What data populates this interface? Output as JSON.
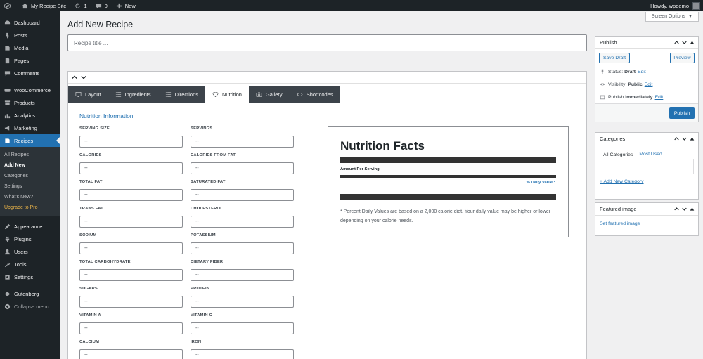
{
  "adminbar": {
    "site_name": "My Recipe Site",
    "updates_count": "1",
    "comments_count": "0",
    "new_label": "New",
    "howdy": "Howdy, wpdemo"
  },
  "sidebar": {
    "items_top": [
      {
        "label": "Dashboard",
        "icon": "dashboard-icon"
      },
      {
        "label": "Posts",
        "icon": "pin-icon"
      },
      {
        "label": "Media",
        "icon": "media-icon"
      },
      {
        "label": "Pages",
        "icon": "page-icon"
      },
      {
        "label": "Comments",
        "icon": "comment-icon"
      }
    ],
    "items_mid": [
      {
        "label": "WooCommerce",
        "icon": "woo-icon"
      },
      {
        "label": "Products",
        "icon": "archive-icon"
      },
      {
        "label": "Analytics",
        "icon": "chart-icon"
      },
      {
        "label": "Marketing",
        "icon": "megaphone-icon"
      }
    ],
    "current": {
      "label": "Recipes",
      "icon": "recipe-icon"
    },
    "submenu": [
      "All Recipes",
      "Add New",
      "Categories",
      "Settings",
      "What's New?",
      "Upgrade to Pro"
    ],
    "items_bottom": [
      {
        "label": "Appearance",
        "icon": "brush-icon"
      },
      {
        "label": "Plugins",
        "icon": "plugin-icon"
      },
      {
        "label": "Users",
        "icon": "users-icon"
      },
      {
        "label": "Tools",
        "icon": "wrench-icon"
      },
      {
        "label": "Settings",
        "icon": "settings-icon"
      }
    ],
    "gutenberg": "Gutenberg",
    "collapse": "Collapse menu"
  },
  "screen_options": "Screen Options",
  "page_title": "Add New Recipe",
  "title_placeholder": "Recipe title ...",
  "tabs": [
    {
      "label": "Layout",
      "icon": "layout-icon"
    },
    {
      "label": "Ingredients",
      "icon": "list-icon"
    },
    {
      "label": "Directions",
      "icon": "list-icon"
    },
    {
      "label": "Nutrition",
      "icon": "heart-icon",
      "active": true
    },
    {
      "label": "Gallery",
      "icon": "camera-icon"
    },
    {
      "label": "Shortcodes",
      "icon": "code-icon"
    }
  ],
  "nutrition": {
    "heading": "Nutrition Information",
    "placeholder": "--",
    "fields": [
      "SERVING SIZE",
      "SERVINGS",
      "CALORIES",
      "CALORIES FROM FAT",
      "TOTAL FAT",
      "SATURATED FAT",
      "TRANS FAT",
      "CHOLESTEROL",
      "SODIUM",
      "POTASSIUM",
      "TOTAL CARBOHYDRATE",
      "DIETARY FIBER",
      "SUGARS",
      "PROTEIN",
      "VITAMIN A",
      "VITAMIN C",
      "CALCIUM",
      "IRON"
    ],
    "facts": {
      "title": "Nutrition Facts",
      "amount": "Amount Per Serving",
      "daily_value": "% Daily Value *",
      "footnote": "* Percent Daily Values are based on a 2,000 calorie diet. Your daily value may be higher or lower depending on your calorie needs."
    }
  },
  "publish": {
    "title": "Publish",
    "save_draft": "Save Draft",
    "preview": "Preview",
    "status_label": "Status:",
    "status_value": "Draft",
    "visibility_label": "Visibility:",
    "visibility_value": "Public",
    "publish_label": "Publish",
    "publish_value": "immediately",
    "edit": "Edit",
    "publish_button": "Publish"
  },
  "categories": {
    "title": "Categories",
    "tab_all": "All Categories",
    "tab_used": "Most Used",
    "add_new": "+ Add New Category"
  },
  "featured": {
    "title": "Featured image",
    "set": "Set featured image"
  },
  "colors": {
    "admin_dark": "#1d2327",
    "accent": "#2271b1",
    "upgrade": "#f0b849"
  }
}
